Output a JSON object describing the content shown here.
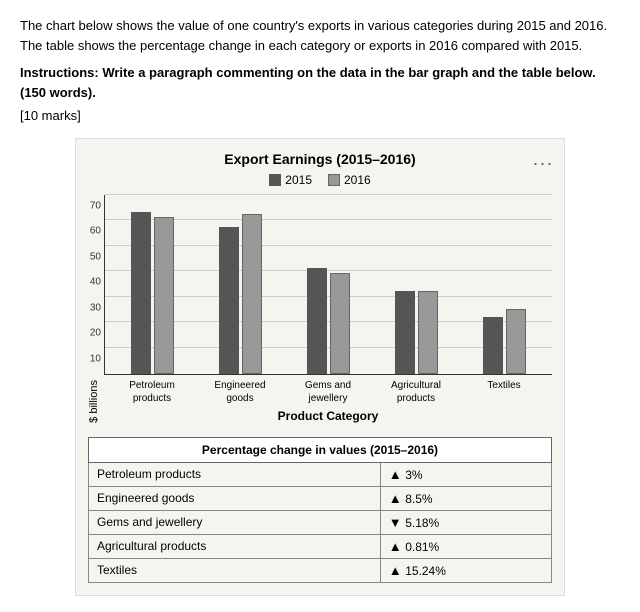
{
  "intro": {
    "text1": "The chart below shows the value of one country's exports in various categories during 2015 and 2016. The table shows the percentage change in each category or exports in 2016 compared with 2015.",
    "instructions": "Instructions: Write a paragraph commenting on the data in the bar graph and the table below. (150 words).",
    "marks": "[10 marks]"
  },
  "chart": {
    "title": "Export Earnings (2015–2016)",
    "legend": {
      "year1": "2015",
      "year2": "2016",
      "color1": "#555",
      "color2": "#888"
    },
    "yaxis_label": "$ billions",
    "yaxis_ticks": [
      10,
      20,
      30,
      40,
      50,
      60,
      70
    ],
    "xaxis_title": "Product Category",
    "categories": [
      {
        "label": "Petroleum\nproducts",
        "val2015": 63,
        "val2016": 61
      },
      {
        "label": "Engineered\ngoods",
        "val2015": 57,
        "val2016": 62
      },
      {
        "label": "Gems and\njewellery",
        "val2015": 41,
        "val2016": 39
      },
      {
        "label": "Agricultural\nproducts",
        "val2015": 32,
        "val2016": 32
      },
      {
        "label": "Textiles",
        "val2015": 22,
        "val2016": 25
      }
    ],
    "max_value": 70,
    "dots_label": "..."
  },
  "table": {
    "header": "Percentage change in values (2015–2016)",
    "rows": [
      {
        "category": "Petroleum products",
        "direction": "up",
        "value": "3%"
      },
      {
        "category": "Engineered goods",
        "direction": "up",
        "value": "8.5%"
      },
      {
        "category": "Gems and jewellery",
        "direction": "down",
        "value": "5.18%"
      },
      {
        "category": "Agricultural products",
        "direction": "up",
        "value": "0.81%"
      },
      {
        "category": "Textiles",
        "direction": "up",
        "value": "15.24%"
      }
    ]
  }
}
